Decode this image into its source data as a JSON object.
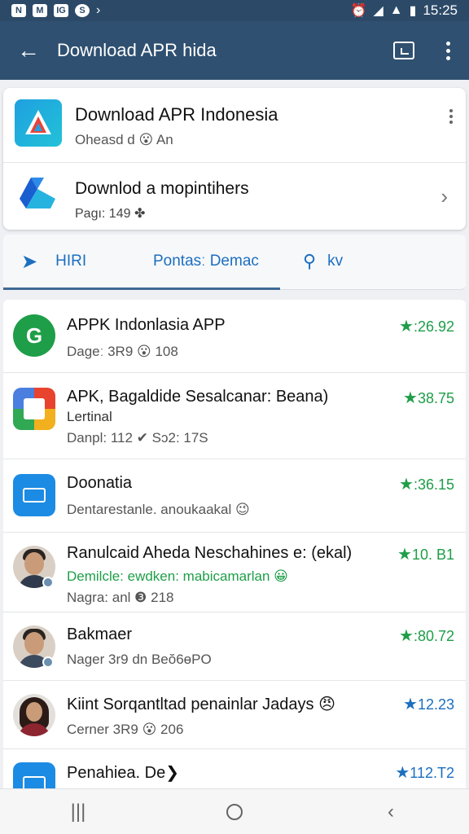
{
  "status_bar": {
    "time": "15:25",
    "left_icons": [
      "N",
      "M",
      "IG",
      "S"
    ]
  },
  "app_bar": {
    "title": "Download APR hida"
  },
  "header_card": {
    "title": "Download APR Indonesia",
    "subtitle": "Oheasd d 😮 An",
    "row2_title": "Downlod a mopintihers",
    "row2_subtitle": "Pagı: 149 ✤"
  },
  "tabs": [
    {
      "label": "HIRI"
    },
    {
      "label": "Pontasː Demac"
    },
    {
      "label": "kv"
    }
  ],
  "items": [
    {
      "title": "APPK Indonlasia APP",
      "line2": "",
      "sub": "Dageː 3R9 😮 108",
      "rating": ":26.92",
      "rating_color": "green"
    },
    {
      "title": "APK, Bagaldide Sesalcanar: Beana)",
      "line2": "Lertinal",
      "sub": "Danpl: 112 ✔ Sɔ2: 17S",
      "rating": "38.75",
      "rating_color": "green"
    },
    {
      "title": "Doonatia",
      "line2": "",
      "sub": "Dentarestanle. anoukaakal 😉",
      "rating": ":36.15",
      "rating_color": "green"
    },
    {
      "title": "Ranulcaid Aheda Neschahines e: (ekal)",
      "line2": "",
      "sub": "Demilcle: ewdken: mabicamarlan 😀",
      "sub2": "Nagra: anl ❸ 218",
      "rating": "10. B1",
      "rating_color": "green"
    },
    {
      "title": "Bakmaer",
      "line2": "",
      "sub": "Nager 3r9 dn Beŏ6ɵPO",
      "rating": ":80.72",
      "rating_color": "green"
    },
    {
      "title": "Kiint Sorqantltad penainlar Jadays 😠",
      "line2": "",
      "sub": "Cerner 3R9 😮 206",
      "rating": "12.23",
      "rating_color": "blue"
    },
    {
      "title": "Penahiea. De❯",
      "line2": "",
      "sub": "",
      "rating": "112.T2",
      "rating_color": "blue"
    }
  ]
}
